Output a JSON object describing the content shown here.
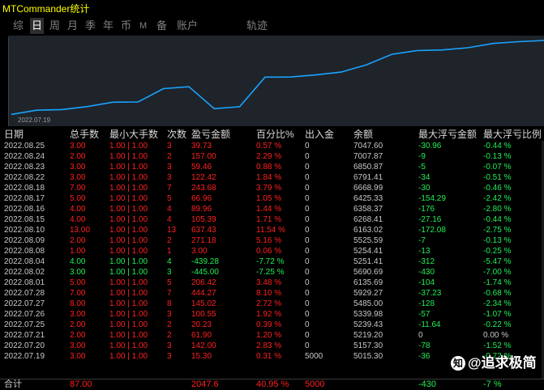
{
  "window": {
    "title": "MTCommander统计"
  },
  "tabs": [
    {
      "label": "综",
      "active": false
    },
    {
      "label": "日",
      "active": true
    },
    {
      "label": "周",
      "active": false
    },
    {
      "label": "月",
      "active": false
    },
    {
      "label": "季",
      "active": false
    },
    {
      "label": "年",
      "active": false
    },
    {
      "label": "币",
      "active": false
    },
    {
      "label": "M",
      "active": false
    },
    {
      "label": "备",
      "active": false
    },
    {
      "label": "账户",
      "active": false
    },
    {
      "label": "轨迹",
      "active": false
    }
  ],
  "chart": {
    "start_date_label": "2022.07.19",
    "line_color": "#1aa3ff",
    "values": [
      15.3,
      157.3,
      177.5,
      277.6,
      422.6,
      429.6,
      874.3,
      935.9,
      206.5,
      272.2,
      1257.8,
      1258.3,
      1329.7,
      1423.6,
      1665.6,
      2016.7,
      2139.0,
      2160.2,
      2233.6,
      2376.9,
      2436.4,
      2476.1
    ]
  },
  "table": {
    "columns": [
      "日期",
      "总手数",
      "最小大手数",
      "次数",
      "盈亏金额",
      "百分比%",
      "出入金",
      "余额",
      "最大浮亏金额",
      "最大浮亏比例"
    ],
    "rows": [
      {
        "date": "2022.08.25",
        "lots": "3.00",
        "minmax": "1.00 | 1.00",
        "count": "3",
        "pnl": "39.73",
        "pct": "0.57 %",
        "io": "0",
        "bal": "7047.60",
        "fl": "-30.96",
        "flp": "-0.44 %",
        "dir": "pos"
      },
      {
        "date": "2022.08.24",
        "lots": "2.00",
        "minmax": "1.00 | 1.00",
        "count": "2",
        "pnl": "157.00",
        "pct": "2.29 %",
        "io": "0",
        "bal": "7007.87",
        "fl": "-9",
        "flp": "-0.13 %",
        "dir": "pos"
      },
      {
        "date": "2022.08.23",
        "lots": "3.00",
        "minmax": "1.00 | 1.00",
        "count": "3",
        "pnl": "59.46",
        "pct": "0.88 %",
        "io": "0",
        "bal": "6850.87",
        "fl": "-5",
        "flp": "-0.07 %",
        "dir": "pos"
      },
      {
        "date": "2022.08.22",
        "lots": "3.00",
        "minmax": "1.00 | 1.00",
        "count": "3",
        "pnl": "122.42",
        "pct": "1.84 %",
        "io": "0",
        "bal": "6791.41",
        "fl": "-34",
        "flp": "-0.51 %",
        "dir": "pos"
      },
      {
        "date": "2022.08.18",
        "lots": "7.00",
        "minmax": "1.00 | 1.00",
        "count": "7",
        "pnl": "243.68",
        "pct": "3.79 %",
        "io": "0",
        "bal": "6668.99",
        "fl": "-30",
        "flp": "-0.46 %",
        "dir": "pos"
      },
      {
        "date": "2022.08.17",
        "lots": "5.00",
        "minmax": "1.00 | 1.00",
        "count": "5",
        "pnl": "66.96",
        "pct": "1.05 %",
        "io": "0",
        "bal": "6425.33",
        "fl": "-154.29",
        "flp": "-2.42 %",
        "dir": "pos"
      },
      {
        "date": "2022.08.16",
        "lots": "4.00",
        "minmax": "1.00 | 1.00",
        "count": "4",
        "pnl": "89.96",
        "pct": "1.44 %",
        "io": "0",
        "bal": "6358.37",
        "fl": "-176",
        "flp": "-2.80 %",
        "dir": "pos"
      },
      {
        "date": "2022.08.15",
        "lots": "4.00",
        "minmax": "1.00 | 1.00",
        "count": "4",
        "pnl": "105.39",
        "pct": "1.71 %",
        "io": "0",
        "bal": "6268.41",
        "fl": "-27.16",
        "flp": "-0.44 %",
        "dir": "pos"
      },
      {
        "date": "2022.08.10",
        "lots": "13.00",
        "minmax": "1.00 | 1.00",
        "count": "13",
        "pnl": "637.43",
        "pct": "11.54 %",
        "io": "0",
        "bal": "6163.02",
        "fl": "-172.08",
        "flp": "-2.75 %",
        "dir": "pos"
      },
      {
        "date": "2022.08.09",
        "lots": "2.00",
        "minmax": "1.00 | 1.00",
        "count": "2",
        "pnl": "271.18",
        "pct": "5.16 %",
        "io": "0",
        "bal": "5525.59",
        "fl": "-7",
        "flp": "-0.13 %",
        "dir": "pos"
      },
      {
        "date": "2022.08.08",
        "lots": "1.00",
        "minmax": "1.00 | 1.00",
        "count": "1",
        "pnl": "3.00",
        "pct": "0.06 %",
        "io": "0",
        "bal": "5254.41",
        "fl": "-13",
        "flp": "-0.25 %",
        "dir": "pos"
      },
      {
        "date": "2022.08.04",
        "lots": "4.00",
        "minmax": "1.00 | 1.00",
        "count": "4",
        "pnl": "-439.28",
        "pct": "-7.72 %",
        "io": "0",
        "bal": "5251.41",
        "fl": "-312",
        "flp": "-5.47 %",
        "dir": "neg"
      },
      {
        "date": "2022.08.02",
        "lots": "3.00",
        "minmax": "1.00 | 1.00",
        "count": "3",
        "pnl": "-445.00",
        "pct": "-7.25 %",
        "io": "0",
        "bal": "5690.69",
        "fl": "-430",
        "flp": "-7.00 %",
        "dir": "neg"
      },
      {
        "date": "2022.08.01",
        "lots": "5.00",
        "minmax": "1.00 | 1.00",
        "count": "5",
        "pnl": "206.42",
        "pct": "3.48 %",
        "io": "0",
        "bal": "6135.69",
        "fl": "-104",
        "flp": "-1.74 %",
        "dir": "pos"
      },
      {
        "date": "2022.07.28",
        "lots": "7.00",
        "minmax": "1.00 | 1.00",
        "count": "7",
        "pnl": "444.27",
        "pct": "8.10 %",
        "io": "0",
        "bal": "5929.27",
        "fl": "-37.23",
        "flp": "-0.68 %",
        "dir": "pos"
      },
      {
        "date": "2022.07.27",
        "lots": "8.00",
        "minmax": "1.00 | 1.00",
        "count": "8",
        "pnl": "145.02",
        "pct": "2.72 %",
        "io": "0",
        "bal": "5485.00",
        "fl": "-128",
        "flp": "-2.34 %",
        "dir": "pos"
      },
      {
        "date": "2022.07.26",
        "lots": "3.00",
        "minmax": "1.00 | 1.00",
        "count": "3",
        "pnl": "100.55",
        "pct": "1.92 %",
        "io": "0",
        "bal": "5339.98",
        "fl": "-57",
        "flp": "-1.07 %",
        "dir": "pos"
      },
      {
        "date": "2022.07.25",
        "lots": "2.00",
        "minmax": "1.00 | 1.00",
        "count": "2",
        "pnl": "20.23",
        "pct": "0.39 %",
        "io": "0",
        "bal": "5239.43",
        "fl": "-11.64",
        "flp": "-0.22 %",
        "dir": "pos"
      },
      {
        "date": "2022.07.21",
        "lots": "2.00",
        "minmax": "1.00 | 1.00",
        "count": "2",
        "pnl": "61.90",
        "pct": "1.20 %",
        "io": "0",
        "bal": "5219.20",
        "fl": "0",
        "flp": "0.00 %",
        "dir": "pos"
      },
      {
        "date": "2022.07.20",
        "lots": "3.00",
        "minmax": "1.00 | 1.00",
        "count": "3",
        "pnl": "142.00",
        "pct": "2.83 %",
        "io": "0",
        "bal": "5157.30",
        "fl": "-78",
        "flp": "-1.52 %",
        "dir": "pos"
      },
      {
        "date": "2022.07.19",
        "lots": "3.00",
        "minmax": "1.00 | 1.00",
        "count": "3",
        "pnl": "15.30",
        "pct": "0.31 %",
        "io": "5000",
        "bal": "5015.30",
        "fl": "-36",
        "flp": "-0.72 %",
        "dir": "pos"
      }
    ],
    "total": {
      "label": "合计",
      "lots": "87.00",
      "pnl": "2047.6",
      "pct": "40.95 %",
      "io": "5000",
      "fl": "-430",
      "flp": "-7 %"
    }
  },
  "watermark": {
    "text": "@追求极简"
  },
  "colors": {
    "accent": "#ffff00",
    "positive": "#ff2020",
    "negative": "#22ee55",
    "line": "#1aa3ff"
  }
}
